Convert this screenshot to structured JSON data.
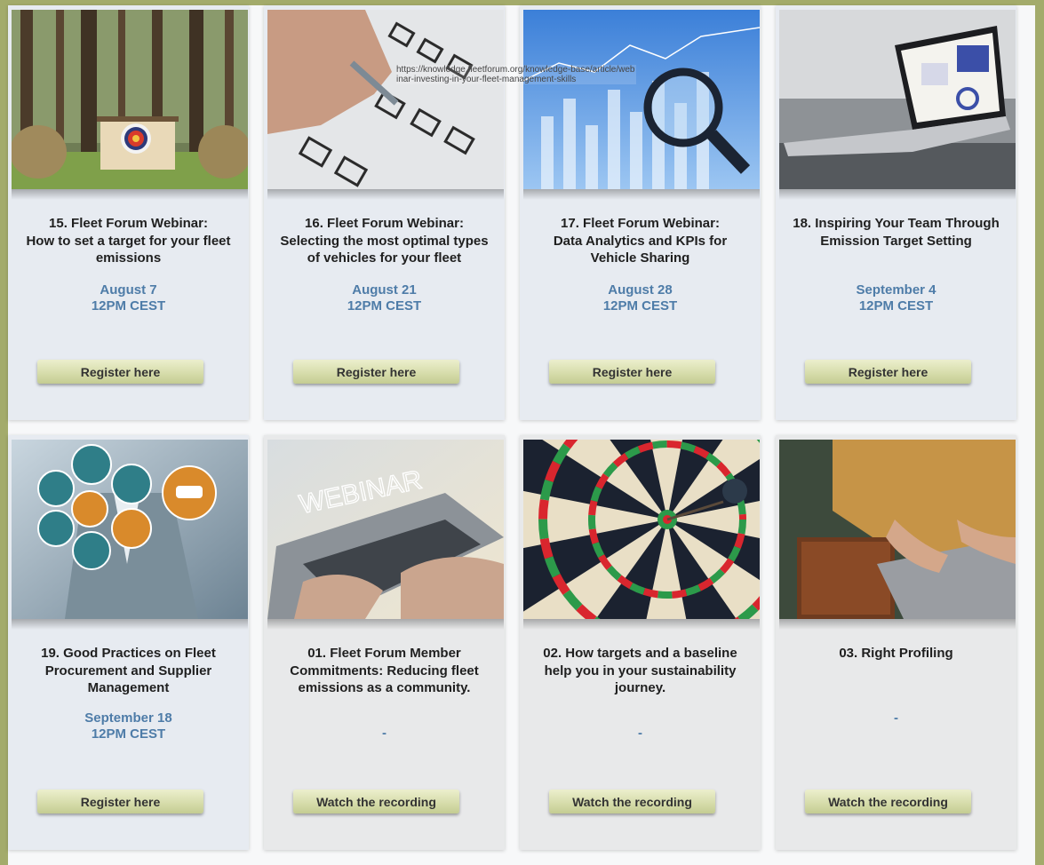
{
  "colors": {
    "frame": "#a3ab6b",
    "card_upcoming": "#e7ebf1",
    "card_past": "#e8e9ea",
    "date_text": "#4e7ca8",
    "button_gradient_top": "#ecefcd",
    "button_gradient_bottom": "#c4cc92"
  },
  "tooltip": "https://knowledge.fleetforum.org/knowledge-base/article/webinar-investing-in-your-fleet-management-skills",
  "cards": [
    {
      "image": "archery-target-in-forest-image",
      "title": "15. Fleet Forum Webinar:\nHow to set a target for your fleet emissions",
      "date": "August 7\n12PM CEST",
      "button": "Register here"
    },
    {
      "image": "checklist-pen-image",
      "title": "16.  Fleet Forum Webinar:\nSelecting the most optimal types of vehicles for your fleet",
      "date": "August 21\n12PM CEST",
      "button": "Register here"
    },
    {
      "image": "data-analytics-magnifier-image",
      "title": "17.  Fleet Forum Webinar:\nData Analytics and KPIs for Vehicle Sharing",
      "date": "August 28\n12PM CEST",
      "button": "Register here"
    },
    {
      "image": "laptop-dashboard-image",
      "title": "18.  Inspiring Your Team Through Emission Target Setting",
      "date": "September 4\n12PM CEST",
      "button": "Register here"
    },
    {
      "image": "ev-charging-icons-businessman-image",
      "title": "19. Good Practices on Fleet Procurement and Supplier Management",
      "date": "September 18\n12PM CEST",
      "button": "Register here"
    },
    {
      "image": "webinar-laptop-image",
      "title": "01. Fleet Forum Member Commitments: Reducing fleet emissions as a community.",
      "date": "-",
      "button": "Watch the recording"
    },
    {
      "image": "dartboard-bullseye-image",
      "title": "02. How targets and a baseline help you in your sustainability journey.",
      "date": "-",
      "button": "Watch the recording"
    },
    {
      "image": "woman-laptop-sweater-image",
      "title": "03. Right Profiling",
      "date": "-",
      "button": "Watch the recording"
    }
  ]
}
